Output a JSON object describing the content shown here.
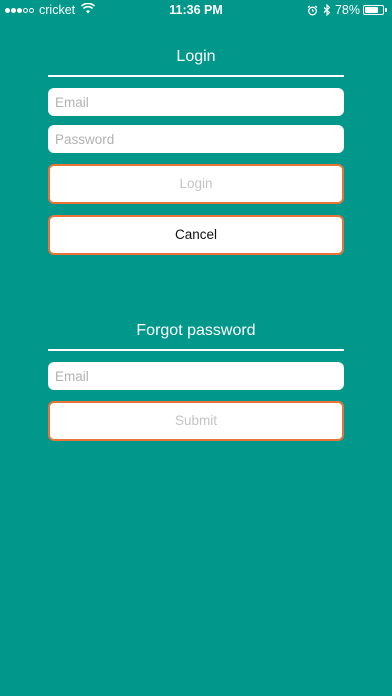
{
  "status_bar": {
    "carrier": "cricket",
    "time": "11:36 PM",
    "battery": "78%",
    "battery_level": 0.78,
    "signal_bars_filled": 3,
    "signal_bars_total": 5,
    "icons": [
      "wifi-icon",
      "alarm-icon",
      "bluetooth-icon",
      "battery-icon"
    ]
  },
  "login": {
    "title": "Login",
    "email_placeholder": "Email",
    "password_placeholder": "Password",
    "login_label": "Login",
    "cancel_label": "Cancel"
  },
  "forgot": {
    "title": "Forgot password",
    "email_placeholder": "Email",
    "submit_label": "Submit"
  },
  "colors": {
    "background": "#01978a",
    "button_border": "#e8743a",
    "input_background": "#ffffff"
  }
}
